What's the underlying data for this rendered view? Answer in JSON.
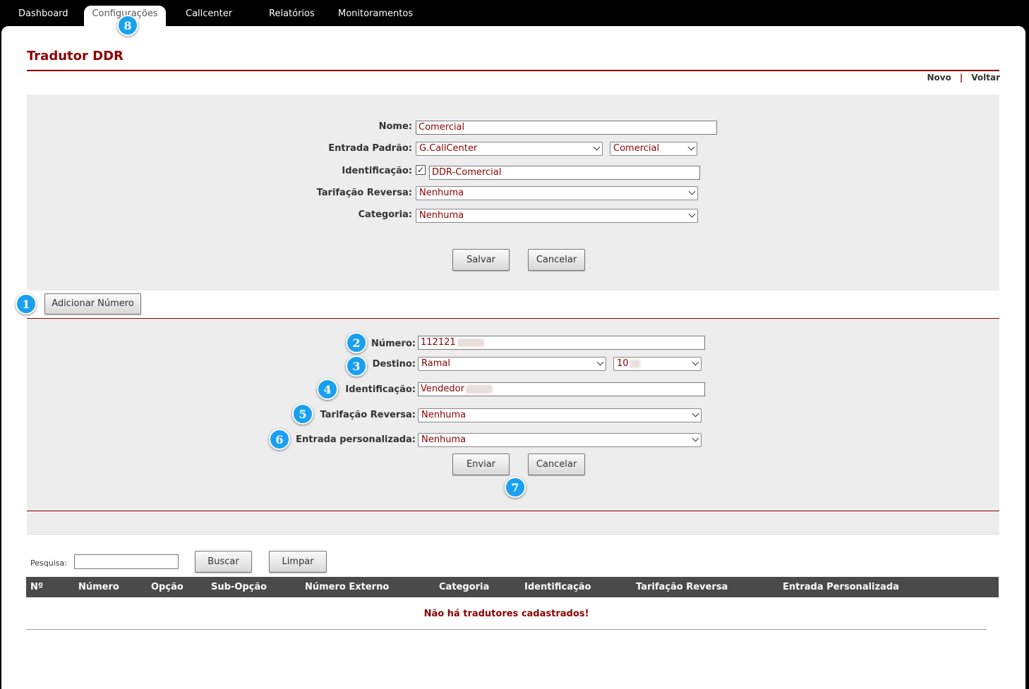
{
  "nav": {
    "tabs": [
      {
        "label": "Dashboard"
      },
      {
        "label": "Configurações"
      },
      {
        "label": "Callcenter"
      },
      {
        "label": "Relatórios"
      },
      {
        "label": "Monitoramentos"
      }
    ]
  },
  "page": {
    "title": "Tradutor DDR",
    "actions": {
      "new": "Novo",
      "separator": "|",
      "back": "Voltar"
    }
  },
  "main_form": {
    "name_label": "Nome:",
    "name_value": "Comercial",
    "entry_label": "Entrada Padrão:",
    "entry_value": "G.CallCenter",
    "entry_sub_value": "Comercial",
    "ident_label": "Identificação:",
    "ident_checked": true,
    "ident_value": "DDR-Comercial",
    "tariff_label": "Tarifação Reversa:",
    "tariff_value": "Nenhuma",
    "category_label": "Categoria:",
    "category_value": "Nenhuma",
    "save_label": "Salvar",
    "cancel_label": "Cancelar"
  },
  "add_number_label": "Adicionar Número",
  "number_form": {
    "number_label": "Número:",
    "number_value": "112121",
    "dest_label": "Destino:",
    "dest_value": "Ramal",
    "dest_sub_value": "10",
    "ident_label": "Identificação:",
    "ident_value": "Vendedor",
    "tariff_label": "Tarifação Reversa:",
    "tariff_value": "Nenhuma",
    "custom_label": "Entrada personalizada:",
    "custom_value": "Nenhuma",
    "send_label": "Enviar",
    "cancel_label": "Cancelar"
  },
  "search": {
    "label": "Pesquisa:",
    "value": "",
    "search_label": "Buscar",
    "clear_label": "Limpar"
  },
  "table": {
    "columns": [
      "Nº",
      "Número",
      "Opção",
      "Sub-Opção",
      "Número Externo",
      "Categoria",
      "Identificação",
      "Tarifação Reversa",
      "Entrada Personalizada"
    ],
    "empty_message": "Não há tradutores cadastrados!"
  },
  "callouts": [
    "1",
    "2",
    "3",
    "4",
    "5",
    "6",
    "7",
    "8"
  ],
  "colors": {
    "accent": "#8b0000",
    "callout": "#1aa0f0",
    "header_bg": "#4a4a4a"
  }
}
